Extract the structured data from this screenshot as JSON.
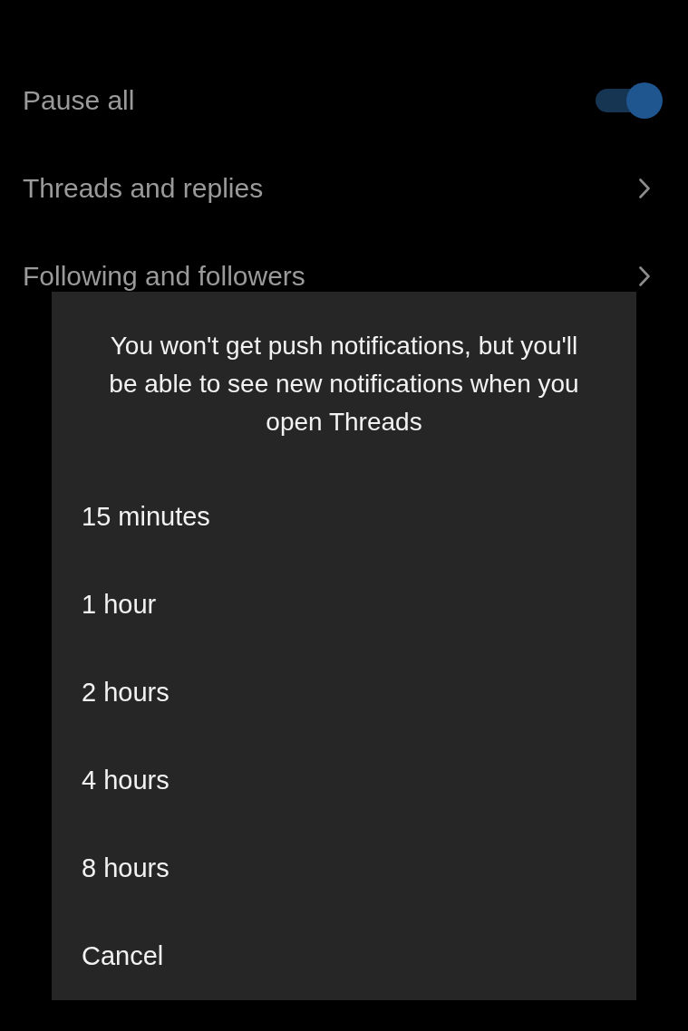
{
  "settings": {
    "items": [
      {
        "kind": "toggle",
        "label": "Pause all",
        "on": true
      },
      {
        "kind": "link",
        "label": "Threads and replies"
      },
      {
        "kind": "link",
        "label": "Following and followers"
      }
    ]
  },
  "dialog": {
    "message": "You won't get push notifications, but you'll be able to see new notifications when you open Threads",
    "options": [
      {
        "label": "15 minutes"
      },
      {
        "label": "1 hour"
      },
      {
        "label": "2 hours"
      },
      {
        "label": "4 hours"
      },
      {
        "label": "8 hours"
      }
    ],
    "cancel": "Cancel"
  }
}
